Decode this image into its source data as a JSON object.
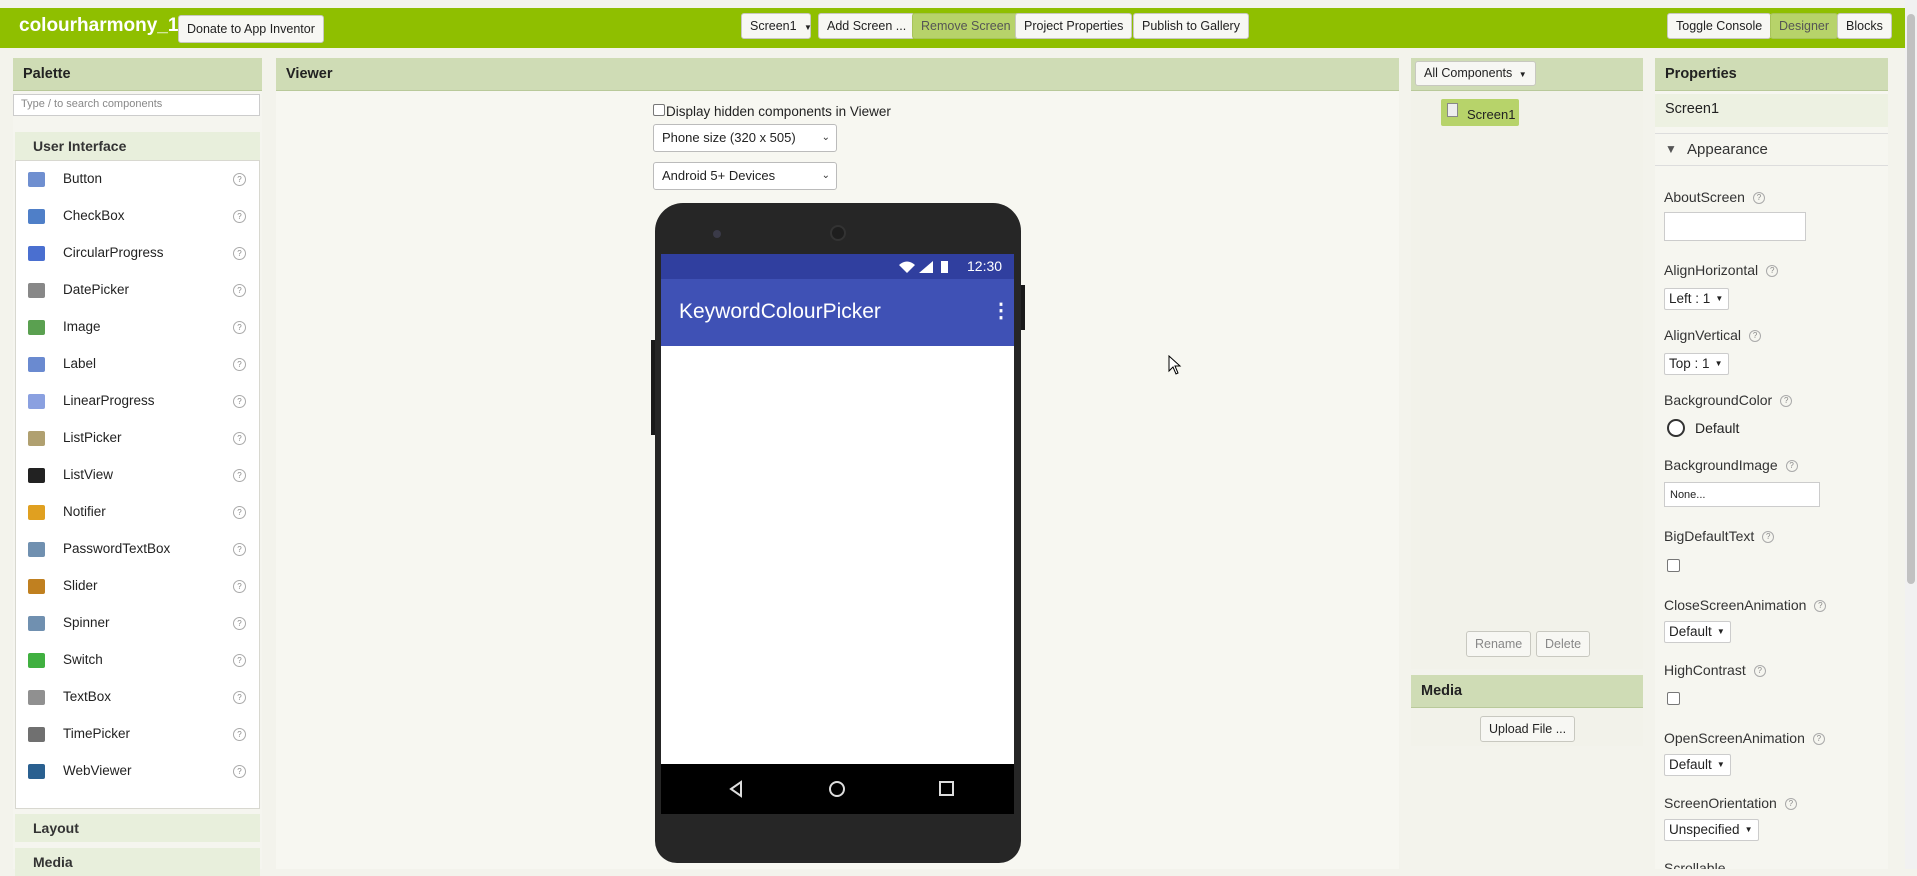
{
  "app": {
    "title": "colourharmony_1",
    "donate_label": "Donate to App Inventor"
  },
  "toolbar": {
    "screen_select": "Screen1",
    "add_screen": "Add Screen ...",
    "remove_screen": "Remove Screen",
    "project_properties": "Project Properties",
    "publish": "Publish to Gallery",
    "toggle_console": "Toggle Console",
    "designer": "Designer",
    "blocks": "Blocks"
  },
  "palette": {
    "title": "Palette",
    "search_placeholder": "Type / to search components",
    "category": "User Interface",
    "items": [
      {
        "label": "Button",
        "icon": "button-icon",
        "color": "#6f8fd0"
      },
      {
        "label": "CheckBox",
        "icon": "checkbox-icon",
        "color": "#4f7fc8"
      },
      {
        "label": "CircularProgress",
        "icon": "circular-progress-icon",
        "color": "#4a6fd0"
      },
      {
        "label": "DatePicker",
        "icon": "datepicker-icon",
        "color": "#888888"
      },
      {
        "label": "Image",
        "icon": "image-icon",
        "color": "#5aa050"
      },
      {
        "label": "Label",
        "icon": "label-icon",
        "color": "#6a8ad0"
      },
      {
        "label": "LinearProgress",
        "icon": "linear-progress-icon",
        "color": "#8aa0e0"
      },
      {
        "label": "ListPicker",
        "icon": "listpicker-icon",
        "color": "#b0a070"
      },
      {
        "label": "ListView",
        "icon": "listview-icon",
        "color": "#222222"
      },
      {
        "label": "Notifier",
        "icon": "notifier-icon",
        "color": "#e0a020"
      },
      {
        "label": "PasswordTextBox",
        "icon": "password-textbox-icon",
        "color": "#7090b0"
      },
      {
        "label": "Slider",
        "icon": "slider-icon",
        "color": "#c08020"
      },
      {
        "label": "Spinner",
        "icon": "spinner-icon",
        "color": "#7090b0"
      },
      {
        "label": "Switch",
        "icon": "switch-icon",
        "color": "#40b040"
      },
      {
        "label": "TextBox",
        "icon": "textbox-icon",
        "color": "#909090"
      },
      {
        "label": "TimePicker",
        "icon": "timepicker-icon",
        "color": "#707070"
      },
      {
        "label": "WebViewer",
        "icon": "webviewer-icon",
        "color": "#2a6090"
      }
    ],
    "help_glyph": "?",
    "layout_category": "Layout",
    "media_category": "Media"
  },
  "viewer": {
    "title": "Viewer",
    "hidden_checkbox_label": "Display hidden components in Viewer",
    "size_select": "Phone size (320 x 505)",
    "device_select": "Android 5+ Devices",
    "phone": {
      "time": "12:30",
      "app_title": "KeywordColourPicker"
    }
  },
  "components": {
    "select": "All Components",
    "tree_item": "Screen1",
    "rename": "Rename",
    "delete": "Delete"
  },
  "media": {
    "title": "Media",
    "upload": "Upload File ..."
  },
  "properties": {
    "title": "Properties",
    "component": "Screen1",
    "section": "Appearance",
    "about_screen": "AboutScreen",
    "align_horizontal": "AlignHorizontal",
    "align_horizontal_value": "Left : 1",
    "align_vertical": "AlignVertical",
    "align_vertical_value": "Top : 1",
    "background_color": "BackgroundColor",
    "background_color_value": "Default",
    "background_image": "BackgroundImage",
    "background_image_value": "None...",
    "big_default_text": "BigDefaultText",
    "close_animation": "CloseScreenAnimation",
    "close_animation_value": "Default",
    "high_contrast": "HighContrast",
    "open_animation": "OpenScreenAnimation",
    "open_animation_value": "Default",
    "orientation": "ScreenOrientation",
    "orientation_value": "Unspecified",
    "next_partial": "Scrollable"
  },
  "colors": {
    "topbar": "#8fbf00",
    "panel_header": "#cfdcb5",
    "phone_statusbar": "#303f9f",
    "phone_appbar": "#3f51b5"
  }
}
